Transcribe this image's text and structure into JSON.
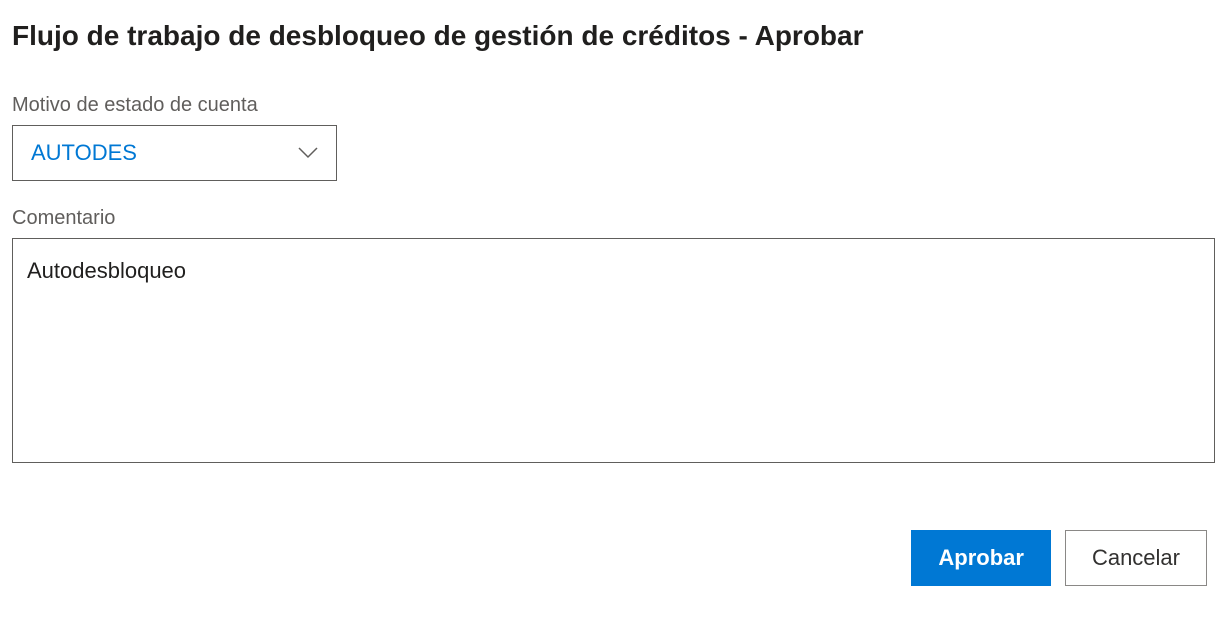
{
  "dialog": {
    "title": "Flujo de trabajo de desbloqueo de gestión de créditos - Aprobar"
  },
  "fields": {
    "reason": {
      "label": "Motivo de estado de cuenta",
      "value": "AUTODES"
    },
    "comment": {
      "label": "Comentario",
      "value": "Autodesbloqueo"
    }
  },
  "buttons": {
    "approve": "Aprobar",
    "cancel": "Cancelar"
  }
}
